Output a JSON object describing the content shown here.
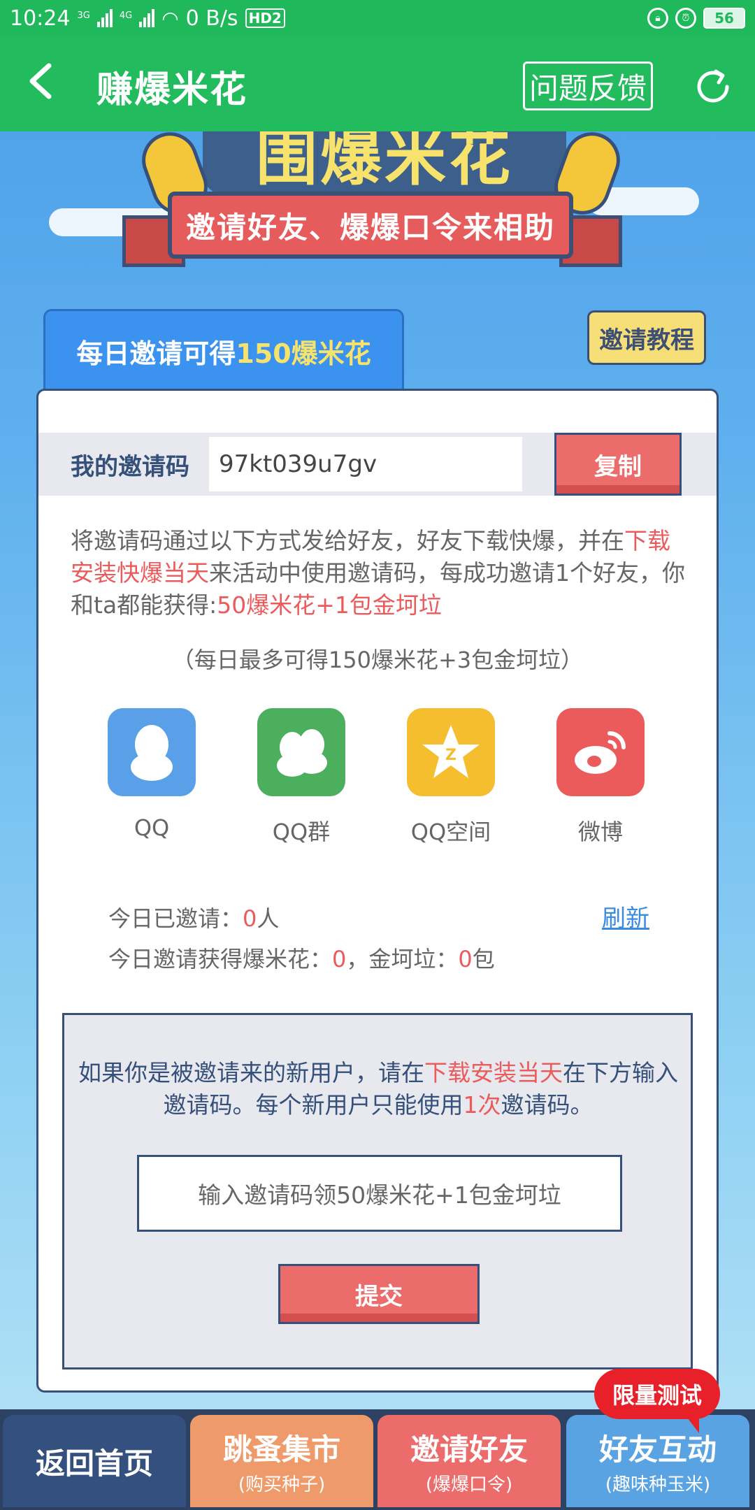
{
  "status_bar": {
    "time": "10:24",
    "net1": "3G",
    "net2": "4G",
    "speed": "0 B/s",
    "hd": "HD2",
    "battery": "56"
  },
  "app_bar": {
    "back_icon": "chevron-left-icon",
    "title": "赚爆米花",
    "feedback_label": "问题反馈",
    "refresh_icon": "refresh-icon"
  },
  "banner": {
    "title": "围爆米花",
    "subtitle": "邀请好友、爆爆口令来相助"
  },
  "tab": {
    "prefix": "每日邀请可得",
    "highlight": "150爆米花"
  },
  "tutorial_label": "邀请教程",
  "invite": {
    "code_label": "我的邀请码",
    "code_value": "97kt039u7gv",
    "copy_label": "复制"
  },
  "description": {
    "part1": "将邀请码通过以下方式发给好友，好友下载快爆，并在",
    "part1_red": "下载安装快爆当天",
    "part2": "来活动中使用邀请码，每成功邀请1个好友，你和ta都能获得:",
    "part2_red": "50爆米花+1包金坷垃"
  },
  "daily_max": "（每日最多可得150爆米花+3包金坷垃）",
  "share": [
    {
      "label": "QQ",
      "icon": "qq-icon",
      "color": "#5aa0e8"
    },
    {
      "label": "QQ群",
      "icon": "qq-group-icon",
      "color": "#4caf5e"
    },
    {
      "label": "QQ空间",
      "icon": "qzone-icon",
      "color": "#f5be2e"
    },
    {
      "label": "微博",
      "icon": "weibo-icon",
      "color": "#ec5b5b"
    }
  ],
  "stats": {
    "invited_label": "今日已邀请：",
    "invited_count": "0",
    "invited_unit": "人",
    "earned_label": "今日邀请获得爆米花：",
    "earned_popcorn": "0",
    "earned_mid": "，金坷垃：",
    "earned_fertilizer": "0",
    "earned_unit": "包",
    "refresh_label": "刷新"
  },
  "new_user": {
    "text1": "如果你是被邀请来的新用户，请在",
    "text1_red": "下载安装当天",
    "text2": "在下方输入邀请码。每个新用户只能使用",
    "text2_red": "1次",
    "text3": "邀请码。",
    "input_placeholder": "输入邀请码领50爆米花+1包金坷垃",
    "submit_label": "提交"
  },
  "bottom_nav": [
    {
      "main": "返回首页",
      "sub": "",
      "color": "#33507e"
    },
    {
      "main": "跳蚤集市",
      "sub": "(购买种子)",
      "color": "#ee9a6a"
    },
    {
      "main": "邀请好友",
      "sub": "(爆爆口令)",
      "color": "#ec6b6b"
    },
    {
      "main": "好友互动",
      "sub": "(趣味种玉米)",
      "color": "#5aa3e3"
    }
  ],
  "limited_badge": "限量测试",
  "colors": {
    "app_bar": "#22bb5e",
    "accent_red": "#ec6b6b",
    "navy": "#35507a",
    "tab_blue": "#3b93ef",
    "highlight_yellow": "#f7e36b"
  }
}
